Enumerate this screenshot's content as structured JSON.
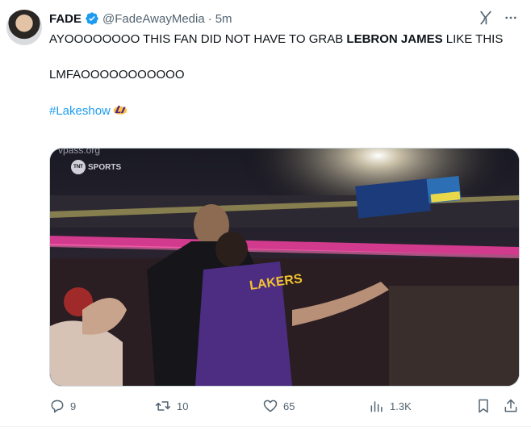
{
  "author": {
    "name": "FADE",
    "handle": "@FadeAwayMedia",
    "time": "5m"
  },
  "tweet": {
    "line1_pre": "AYOOOOOOOO THIS FAN DID NOT HAVE TO GRAB ",
    "line1_bold": "LEBRON JAMES",
    "line1_post": " LIKE THIS",
    "line2": "LMFAOOOOOOOOOOO",
    "hashtag": "#Lakeshow"
  },
  "media": {
    "watermark": "vpass.org",
    "broadcaster": "SPORTS",
    "broadcaster_badge": "TNT",
    "jersey_text": "LAKERS"
  },
  "actions": {
    "replies": "9",
    "reposts": "10",
    "likes": "65",
    "views": "1.3K"
  },
  "colors": {
    "accent": "#1d9bf0",
    "text": "#0f1419",
    "muted": "#536471"
  },
  "icons": [
    "verified-badge-icon",
    "grok-icon",
    "more-icon",
    "lakers-logo-icon",
    "reply-icon",
    "repost-icon",
    "like-icon",
    "views-icon",
    "bookmark-icon",
    "share-icon"
  ]
}
